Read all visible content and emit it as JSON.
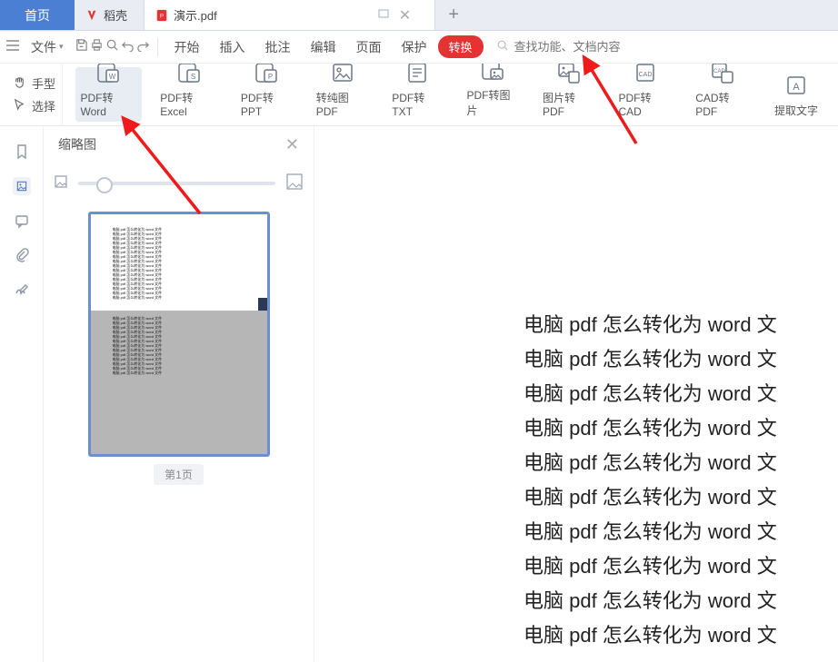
{
  "tabs": {
    "home": "首页",
    "docke": "稻壳",
    "pdf": "演示.pdf"
  },
  "menubar": {
    "file": "文件",
    "start": "开始",
    "insert": "插入",
    "annotate": "批注",
    "edit": "编辑",
    "page": "页面",
    "protect": "保护",
    "convert": "转换",
    "search_placeholder": "查找功能、文档内容"
  },
  "modes": {
    "hand": "手型",
    "select": "选择"
  },
  "ribbon": {
    "pdf2word": "PDF转Word",
    "pdf2excel": "PDF转Excel",
    "pdf2ppt": "PDF转PPT",
    "pdf2pureimg": "转纯图PDF",
    "pdf2txt": "PDF转TXT",
    "pdf2img": "PDF转图片",
    "img2pdf": "图片转PDF",
    "pdf2cad": "PDF转CAD",
    "cad2pdf": "CAD转PDF",
    "extract_text": "提取文字"
  },
  "thumb_panel": {
    "title": "缩略图",
    "page1": "第1页"
  },
  "doc_lines": [
    "电脑 pdf 怎么转化为 word 文",
    "电脑 pdf 怎么转化为 word 文",
    "电脑 pdf 怎么转化为 word 文",
    "电脑 pdf 怎么转化为 word 文",
    "电脑 pdf 怎么转化为 word 文",
    "电脑 pdf 怎么转化为 word 文",
    "电脑 pdf 怎么转化为 word 文",
    "电脑 pdf 怎么转化为 word 文",
    "电脑 pdf 怎么转化为 word 文",
    "电脑 pdf 怎么转化为 word 文"
  ]
}
